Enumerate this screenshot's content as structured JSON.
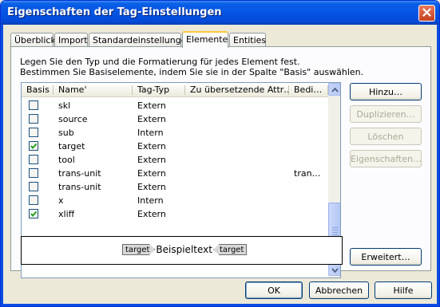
{
  "window": {
    "title": "Eigenschaften der Tag-Einstellungen"
  },
  "tabs": [
    {
      "label": "Überblick",
      "active": false
    },
    {
      "label": "Import",
      "active": false
    },
    {
      "label": "Standardeinstellungen",
      "active": false
    },
    {
      "label": "Elemente",
      "active": true
    },
    {
      "label": "Entities",
      "active": false
    }
  ],
  "description": {
    "line1": "Legen Sie den Typ und die Formatierung für jedes Element fest.",
    "line2": "Bestimmen Sie Basiselemente, indem Sie sie in der Spalte \"Basis\" auswählen."
  },
  "table": {
    "columns": [
      "Basis",
      "Name'",
      "Tag-Typ",
      "Zu übersetzende Attr…",
      "Bedi…"
    ],
    "rows": [
      {
        "basis": false,
        "name": "skl",
        "type": "Extern",
        "attr": "",
        "cond": ""
      },
      {
        "basis": false,
        "name": "source",
        "type": "Extern",
        "attr": "",
        "cond": ""
      },
      {
        "basis": false,
        "name": "sub",
        "type": "Intern",
        "attr": "",
        "cond": ""
      },
      {
        "basis": true,
        "name": "target",
        "type": "Extern",
        "attr": "",
        "cond": ""
      },
      {
        "basis": false,
        "name": "tool",
        "type": "Extern",
        "attr": "",
        "cond": ""
      },
      {
        "basis": false,
        "name": "trans-unit",
        "type": "Extern",
        "attr": "",
        "cond": "tran…"
      },
      {
        "basis": false,
        "name": "trans-unit",
        "type": "Extern",
        "attr": "",
        "cond": ""
      },
      {
        "basis": false,
        "name": "x",
        "type": "Intern",
        "attr": "",
        "cond": ""
      },
      {
        "basis": true,
        "name": "xliff",
        "type": "Extern",
        "attr": "",
        "cond": ""
      }
    ]
  },
  "preview": {
    "tag_label": "target",
    "sample_text": "Beispieltext"
  },
  "side_buttons": {
    "add": "Hinzu…",
    "duplicate": "Duplizieren…",
    "delete": "Löschen",
    "properties": "Eigenschaften…",
    "advanced": "Erweitert…"
  },
  "footer": {
    "ok": "OK",
    "cancel": "Abbrechen",
    "help": "Hilfe"
  },
  "colors": {
    "titlebar": "#0554e3",
    "checkmark": "#21a121",
    "dialog_bg": "#ece9d8"
  },
  "icons": {
    "close": "close-icon",
    "checkbox": "checkbox-icon",
    "scroll_up": "scroll-up-arrow-icon",
    "scroll_down": "scroll-down-arrow-icon"
  }
}
